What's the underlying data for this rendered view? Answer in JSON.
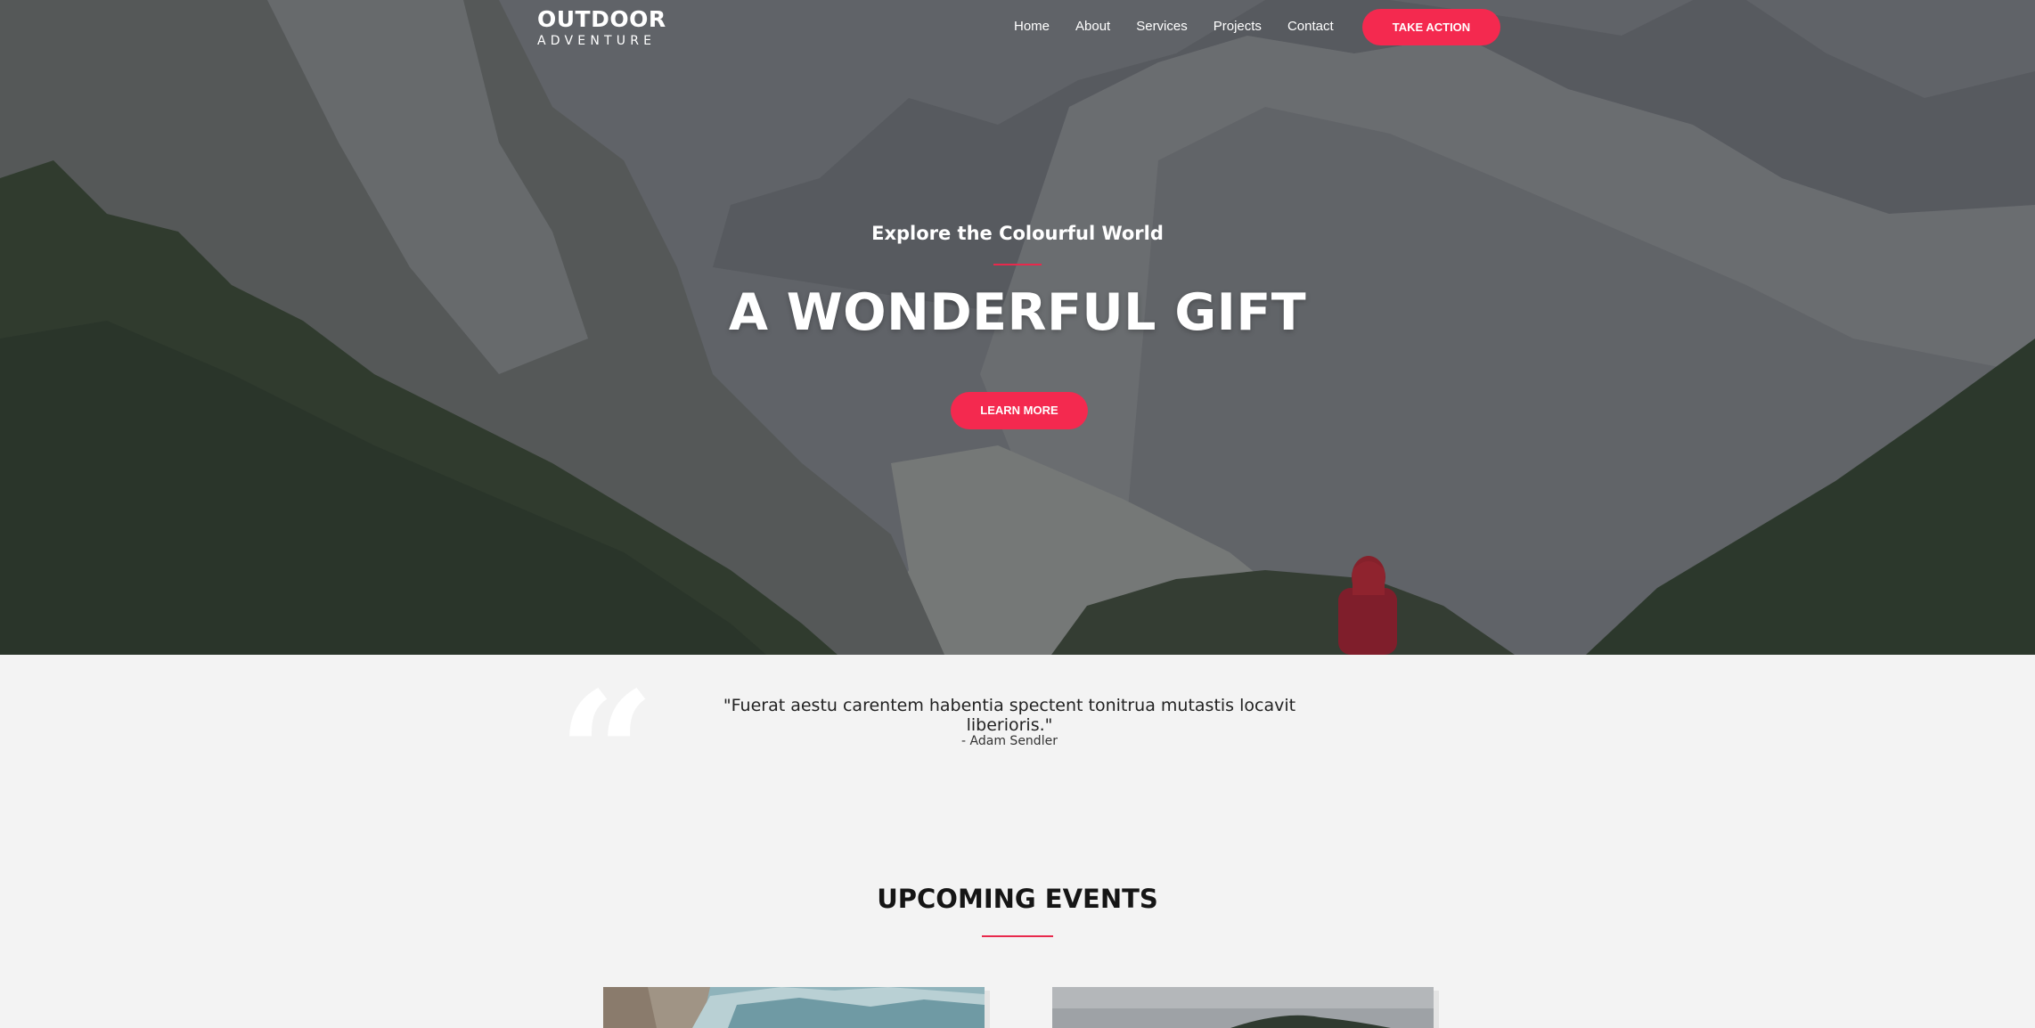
{
  "brand": {
    "line1": "OUTDOOR",
    "line2": "ADVENTURE"
  },
  "nav": {
    "items": [
      "Home",
      "About",
      "Services",
      "Projects",
      "Contact"
    ],
    "cta": "TAKE ACTION"
  },
  "hero": {
    "subtitle": "Explore the Colourful World",
    "title": "A WONDERFUL GIFT",
    "button": "LEARN MORE"
  },
  "testimonial": {
    "mark": "“",
    "quote": "\"Fuerat aestu carentem habentia spectent tonitrua mutastis locavit liberioris.\"",
    "author": "- Adam Sendler"
  },
  "events": {
    "title": "UPCOMING EVENTS"
  },
  "colors": {
    "accent": "#f4294f",
    "background": "#f3f3f3",
    "heading": "#151515"
  }
}
